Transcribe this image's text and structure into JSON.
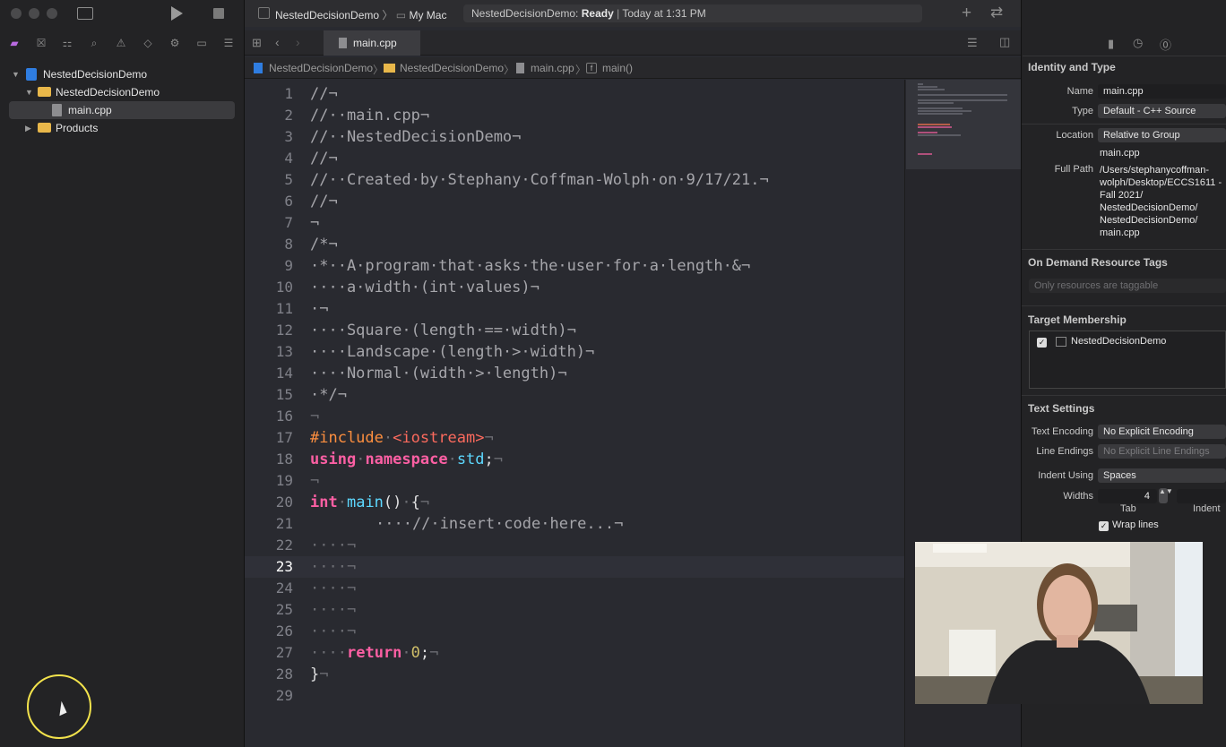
{
  "toolbar": {
    "scheme": "NestedDecisionDemo",
    "destination": "My Mac",
    "status_app": "NestedDecisionDemo:",
    "status_state": "Ready",
    "status_time": "Today at 1:31 PM"
  },
  "navigator": {
    "project": "NestedDecisionDemo",
    "group": "NestedDecisionDemo",
    "file": "main.cpp",
    "products": "Products"
  },
  "tab": {
    "label": "main.cpp"
  },
  "jumpbar": {
    "items": [
      "NestedDecisionDemo",
      "NestedDecisionDemo",
      "main.cpp",
      "main()"
    ]
  },
  "editor": {
    "current_line": "23",
    "lines": [
      {
        "n": "1",
        "t": "//¬"
      },
      {
        "n": "2",
        "t": "//··main.cpp¬"
      },
      {
        "n": "3",
        "t": "//··NestedDecisionDemo¬"
      },
      {
        "n": "4",
        "t": "//¬"
      },
      {
        "n": "5",
        "t": "//··Created·by·Stephany·Coffman-Wolph·on·9/17/21.¬"
      },
      {
        "n": "6",
        "t": "//¬"
      },
      {
        "n": "7",
        "t": "¬"
      },
      {
        "n": "8",
        "t": "/*¬"
      },
      {
        "n": "9",
        "t": "·*··A·program·that·asks·the·user·for·a·length·&¬"
      },
      {
        "n": "10",
        "t": "····a·width·(int·values)¬"
      },
      {
        "n": "11",
        "t": "·¬"
      },
      {
        "n": "12",
        "t": "····Square·(length·==·width)¬"
      },
      {
        "n": "13",
        "t": "····Landscape·(length·>·width)¬"
      },
      {
        "n": "14",
        "t": "····Normal·(width·>·length)¬"
      },
      {
        "n": "15",
        "t": "·*/¬"
      },
      {
        "n": "16",
        "t": "¬"
      },
      {
        "n": "17",
        "t": "#include·<iostream>¬"
      },
      {
        "n": "18",
        "t": "using·namespace·std;¬"
      },
      {
        "n": "19",
        "t": "¬"
      },
      {
        "n": "20",
        "t": "int·main()·{¬"
      },
      {
        "n": "21",
        "t": "····//·insert·code·here...¬"
      },
      {
        "n": "22",
        "t": "····¬"
      },
      {
        "n": "23",
        "t": "····¬"
      },
      {
        "n": "24",
        "t": "····¬"
      },
      {
        "n": "25",
        "t": "····¬"
      },
      {
        "n": "26",
        "t": "····¬"
      },
      {
        "n": "27",
        "t": "····return·0;¬"
      },
      {
        "n": "28",
        "t": "}¬"
      },
      {
        "n": "29",
        "t": ""
      }
    ]
  },
  "inspector": {
    "identity_title": "Identity and Type",
    "name_label": "Name",
    "name_value": "main.cpp",
    "type_label": "Type",
    "type_value": "Default - C++ Source",
    "location_label": "Location",
    "location_value": "Relative to Group",
    "location_file": "main.cpp",
    "fullpath_label": "Full Path",
    "fullpath_lines": [
      "/Users/stephanycoffman-",
      "wolph/Desktop/ECCS1611 -",
      "Fall 2021/",
      "NestedDecisionDemo/",
      "NestedDecisionDemo/",
      "main.cpp"
    ],
    "ondemand_title": "On Demand Resource Tags",
    "ondemand_placeholder": "Only resources are taggable",
    "target_title": "Target Membership",
    "target_item": "NestedDecisionDemo",
    "text_title": "Text Settings",
    "encoding_label": "Text Encoding",
    "encoding_value": "No Explicit Encoding",
    "endings_label": "Line Endings",
    "endings_value": "No Explicit Line Endings",
    "indent_label": "Indent Using",
    "indent_value": "Spaces",
    "widths_label": "Widths",
    "tab_width": "4",
    "tab_label": "Tab",
    "indent_label2": "Indent",
    "wrap_label": "Wrap lines"
  }
}
